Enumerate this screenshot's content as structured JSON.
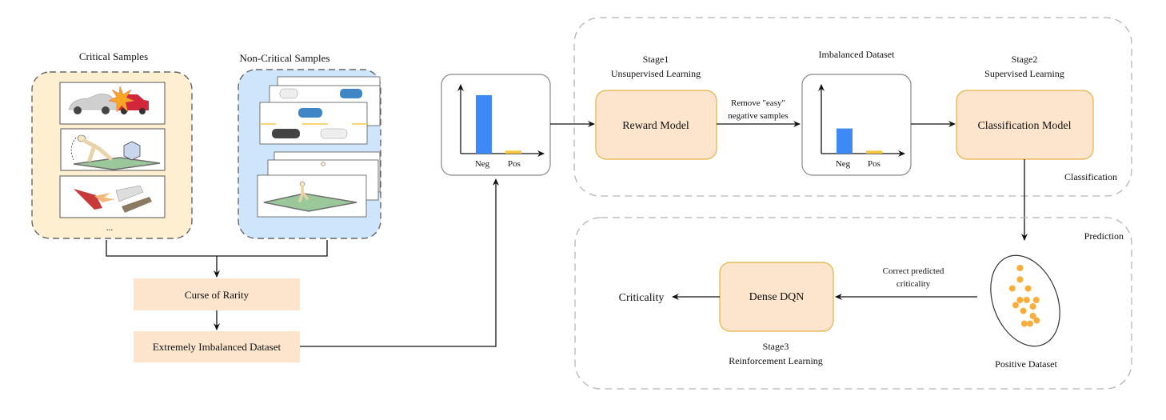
{
  "colors": {
    "critical_bg": "#fdefcf",
    "noncritical_bg": "#cfe5fb",
    "process_box": "#fde4cc",
    "model_box_fill": "#fde4cc",
    "model_box_stroke": "#e6b243",
    "neg_bar": "#3d8af7",
    "pos_bar": "#f9c83a",
    "dot": "#f9ad3a",
    "dashed_gray": "#b5b5b5",
    "dashed_dark": "#666666"
  },
  "left": {
    "critical_title": "Critical Samples",
    "critical_items": [
      "car-collision-image",
      "pedestrian-fall-image",
      "ship-collision-image"
    ],
    "critical_ellipsis": "...",
    "noncritical_title": "Non-Critical Samples",
    "noncritical_items": [
      "highway-traffic-image",
      "pedestrian-walking-image"
    ],
    "curse_label": "Curse of Rarity",
    "imbalanced_label": "Extremely Imbalanced Dataset"
  },
  "chart1": {
    "neg_label": "Neg",
    "pos_label": "Pos"
  },
  "chart2": {
    "title": "Imbalanced Dataset",
    "neg_label": "Neg",
    "pos_label": "Pos"
  },
  "chart_data": [
    {
      "type": "bar",
      "title": "",
      "categories": [
        "Neg",
        "Pos"
      ],
      "values": [
        1.0,
        0.05
      ],
      "xlabel": "",
      "ylabel": "",
      "ylim": [
        0,
        1.15
      ]
    },
    {
      "type": "bar",
      "title": "Imbalanced Dataset",
      "categories": [
        "Neg",
        "Pos"
      ],
      "values": [
        0.43,
        0.05
      ],
      "xlabel": "",
      "ylabel": "",
      "ylim": [
        0,
        1.15
      ]
    }
  ],
  "stage1": {
    "title": "Stage1",
    "subtitle": "Unsupervised Learning",
    "box": "Reward Model"
  },
  "remove_label": [
    "Remove \"easy\"",
    "negative samples"
  ],
  "stage2": {
    "title": "Stage2",
    "subtitle": "Supervised Learning",
    "box": "Classification Model"
  },
  "region_top_label": "Classification",
  "region_bottom_label": "Prediction",
  "positive_dataset": {
    "label": "Positive Dataset",
    "dots": [
      [
        0.49,
        0.15
      ],
      [
        0.49,
        0.33
      ],
      [
        0.33,
        0.47
      ],
      [
        0.66,
        0.47
      ],
      [
        0.49,
        0.65
      ],
      [
        0.63,
        0.65
      ],
      [
        0.83,
        0.65
      ],
      [
        0.4,
        0.73
      ],
      [
        0.56,
        0.82
      ],
      [
        0.76,
        0.75
      ],
      [
        0.76,
        0.9
      ],
      [
        0.84,
        0.97
      ],
      [
        0.58,
        1.02
      ],
      [
        0.7,
        1.02
      ]
    ]
  },
  "correct_label": [
    "Correct predicted",
    "criticality"
  ],
  "stage3": {
    "title": "Stage3",
    "subtitle": "Reinforcement Learning",
    "box": "Dense DQN"
  },
  "output_label": "Criticality"
}
